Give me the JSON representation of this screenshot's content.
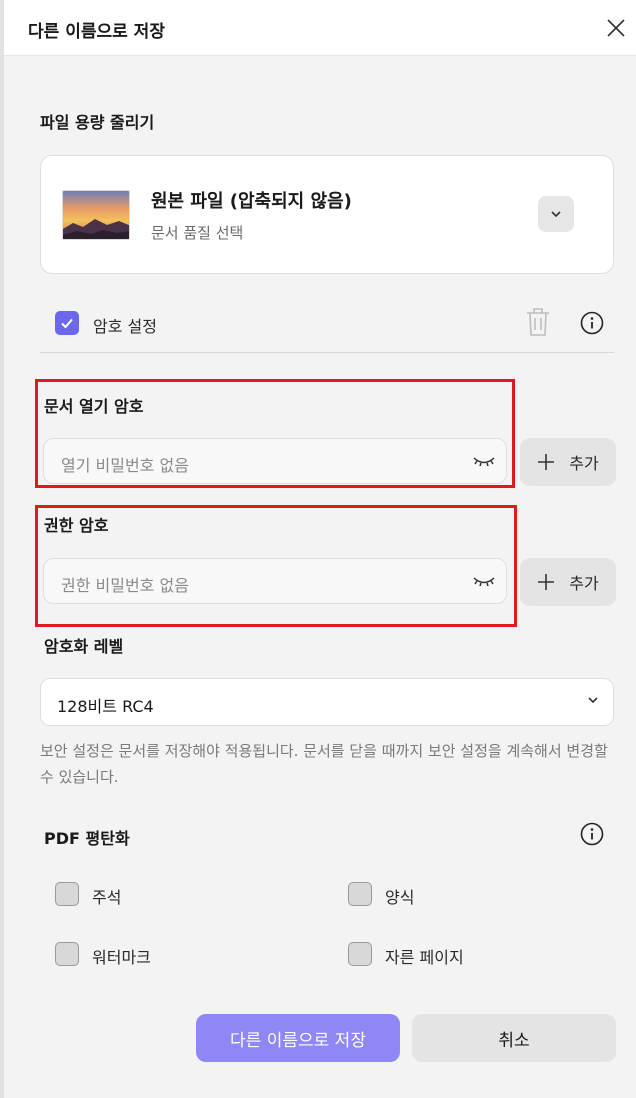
{
  "dialog": {
    "title": "다른 이름으로 저장",
    "close_icon": "close-icon"
  },
  "reduce_size": {
    "label": "파일 용량 줄리기",
    "quality_title": "원본 파일 (압축되지 않음)",
    "quality_subtitle": "문서 품질 선택",
    "expand_icon": "chevron-down-icon"
  },
  "password": {
    "label": "암호 설정",
    "enabled": true,
    "delete_icon": "trash-icon",
    "info_icon": "info-icon"
  },
  "open_password": {
    "label": "문서 열기 암호",
    "placeholder": "열기 비밀번호 없음",
    "add_label": "추가"
  },
  "permission_password": {
    "label": "권한 암호",
    "placeholder": "권한 비밀번호 없음",
    "add_label": "추가"
  },
  "encryption": {
    "label": "암호화 레벨",
    "selected": "128비트 RC4"
  },
  "notice": "보안 설정은 문서를 저장해야 적용됩니다. 문서를 닫을 때까지 보안 설정을 계속해서 변경할 수 있습니다.",
  "flatten": {
    "label": "PDF 평탄화",
    "options": [
      "주석",
      "양식",
      "워터마크",
      "자른 페이지"
    ]
  },
  "actions": {
    "save": "다른 이름으로 저장",
    "cancel": "취소"
  },
  "colors": {
    "accent": "#6d67f0",
    "primary_button": "#8e87f4",
    "highlight": "#e0191e"
  }
}
